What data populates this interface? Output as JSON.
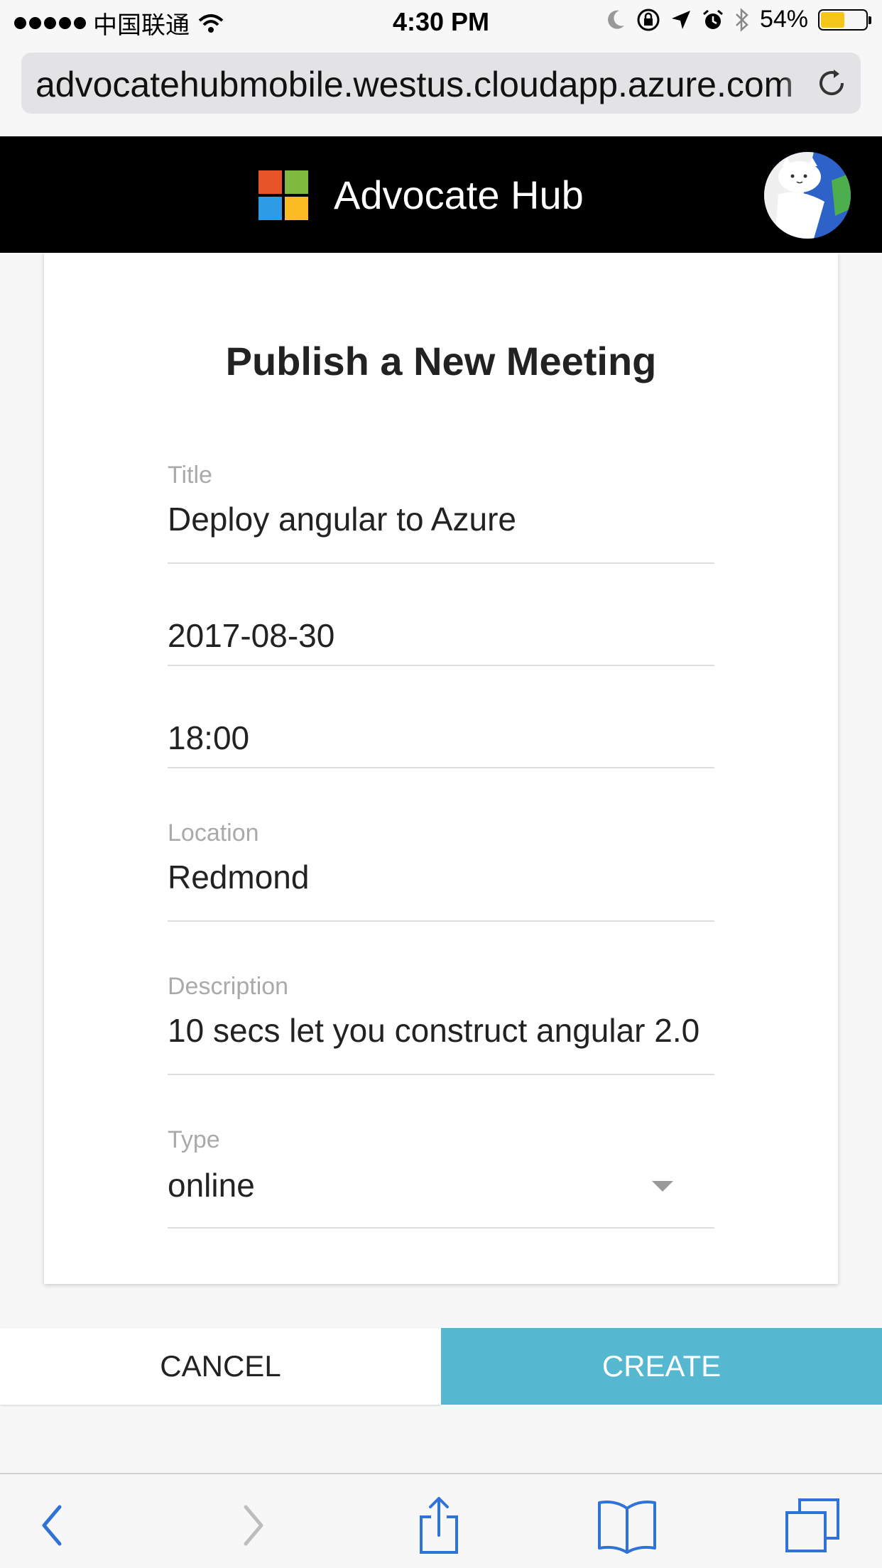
{
  "status_bar": {
    "carrier": "中国联通",
    "time": "4:30 PM",
    "battery": "54%",
    "battery_level": 0.54,
    "icons": [
      "signal-dots-icon",
      "wifi-icon",
      "moon-icon",
      "rotation-lock-icon",
      "location-arrow-icon",
      "alarm-icon",
      "bluetooth-icon",
      "battery-icon"
    ]
  },
  "browser": {
    "url": "advocatehubmobile.westus.cloudapp.azure.com",
    "reload_icon": "reload-icon"
  },
  "header": {
    "app_name": "Advocate Hub",
    "logo": "microsoft-logo",
    "avatar": "user-avatar"
  },
  "form": {
    "heading": "Publish a New Meeting",
    "title_label": "Title",
    "title_value": "Deploy angular to Azure",
    "date_value": "2017-08-30",
    "time_value": "18:00",
    "location_label": "Location",
    "location_value": "Redmond",
    "description_label": "Description",
    "description_value": "10 secs let you construct angular 2.0",
    "type_label": "Type",
    "type_value": "online"
  },
  "actions": {
    "cancel_label": "CANCEL",
    "create_label": "CREATE"
  },
  "colors": {
    "create_button": "#55b8d0",
    "header_bg": "#000000",
    "ms_red": "#e8542a",
    "ms_green": "#7fba3f",
    "ms_blue": "#2e9be6",
    "ms_yellow": "#fbbb22",
    "toolbar_icon": "#2f73d9"
  },
  "toolbar": {
    "icons": [
      "back-icon",
      "forward-icon",
      "share-icon",
      "bookmarks-icon",
      "tabs-icon"
    ]
  }
}
